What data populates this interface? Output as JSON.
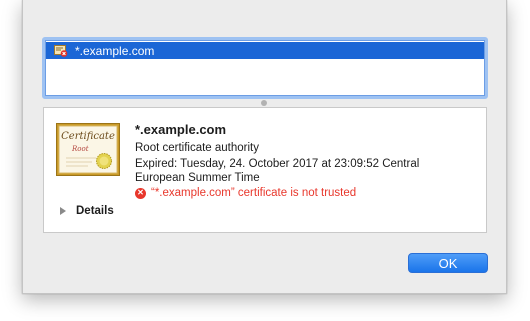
{
  "certificate_list": {
    "selected_row": {
      "label": "*.example.com",
      "icon": "certificate-error-icon"
    }
  },
  "detail": {
    "title": "*.example.com",
    "subtitle": "Root certificate authority",
    "expired_line1": "Expired: Tuesday, 24. October 2017 at 23:09:52 Central",
    "expired_line2": "European Summer Time",
    "warning": "“*.example.com” certificate is not trusted",
    "warning_icon": "error-x-icon",
    "cert_image_text_main": "Certificate",
    "cert_image_text_sub": "Root",
    "details_label": "Details"
  },
  "buttons": {
    "ok_label": "OK"
  },
  "colors": {
    "selection": "#1b66d6",
    "warning": "#e8372c",
    "ok_button": "#1a74ea"
  }
}
